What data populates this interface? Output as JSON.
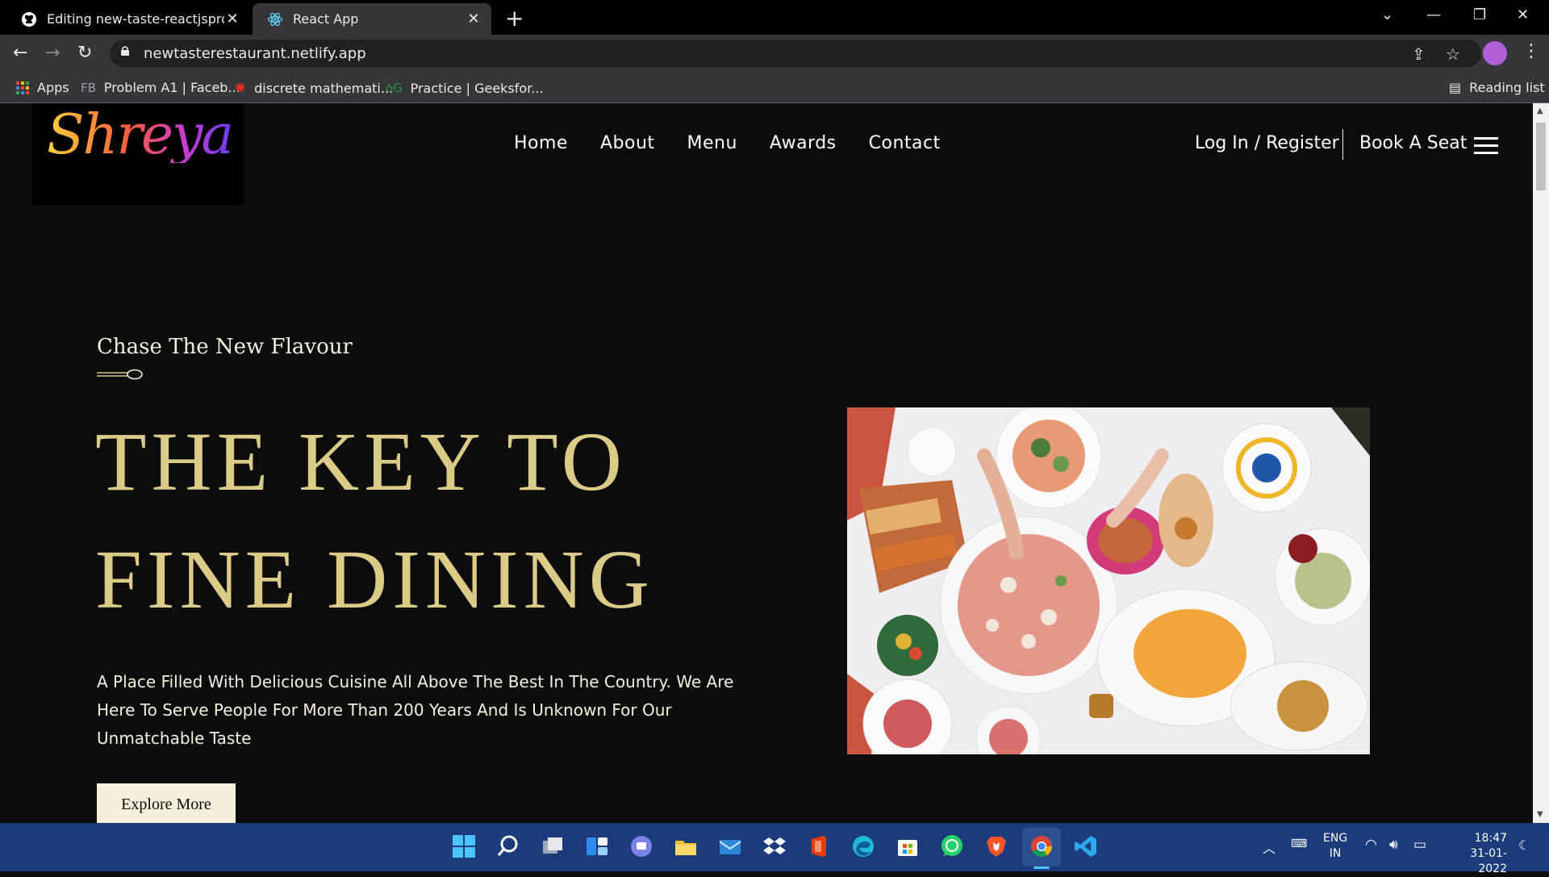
{
  "browser": {
    "tabs": [
      {
        "title": "Editing new-taste-reactjsproject/",
        "active": false,
        "icon": "github-icon"
      },
      {
        "title": "React App",
        "active": true,
        "icon": "react-icon"
      }
    ],
    "url": "newtasterestaurant.netlify.app",
    "bookmarks": [
      {
        "label": "Apps",
        "icon": "apps-grid-icon"
      },
      {
        "label": "Problem A1 | Faceb...",
        "icon": "facebook-fb-icon",
        "prefix": "FB"
      },
      {
        "label": "discrete mathemati...",
        "icon": "red-gear-icon"
      },
      {
        "label": "Practice | Geeksfor...",
        "icon": "geeksforgeeks-icon"
      }
    ],
    "reading_list": "Reading list"
  },
  "site": {
    "logo_text": "Shreya",
    "nav": [
      "Home",
      "About",
      "Menu",
      "Awards",
      "Contact"
    ],
    "login": "Log In / Register",
    "book": "Book A Seat",
    "hero": {
      "subtitle": "Chase The New Flavour",
      "headline_line1": "THE KEY TO",
      "headline_line2": "FINE DINING",
      "description": "A Place Filled With Delicious Cuisine All Above The Best In The Country. We Are Here To Serve People For More Than 200 Years And Is Unknown For Our Unmatchable Taste",
      "button": "Explore More"
    }
  },
  "taskbar": {
    "language": "ENG",
    "region": "IN",
    "time": "18:47",
    "date": "31-01-2022"
  },
  "colors": {
    "page_bg": "#0c0c0c",
    "gold": "#dcca87",
    "cream": "#f5efdb",
    "taskbar": "#1b3b7a"
  }
}
